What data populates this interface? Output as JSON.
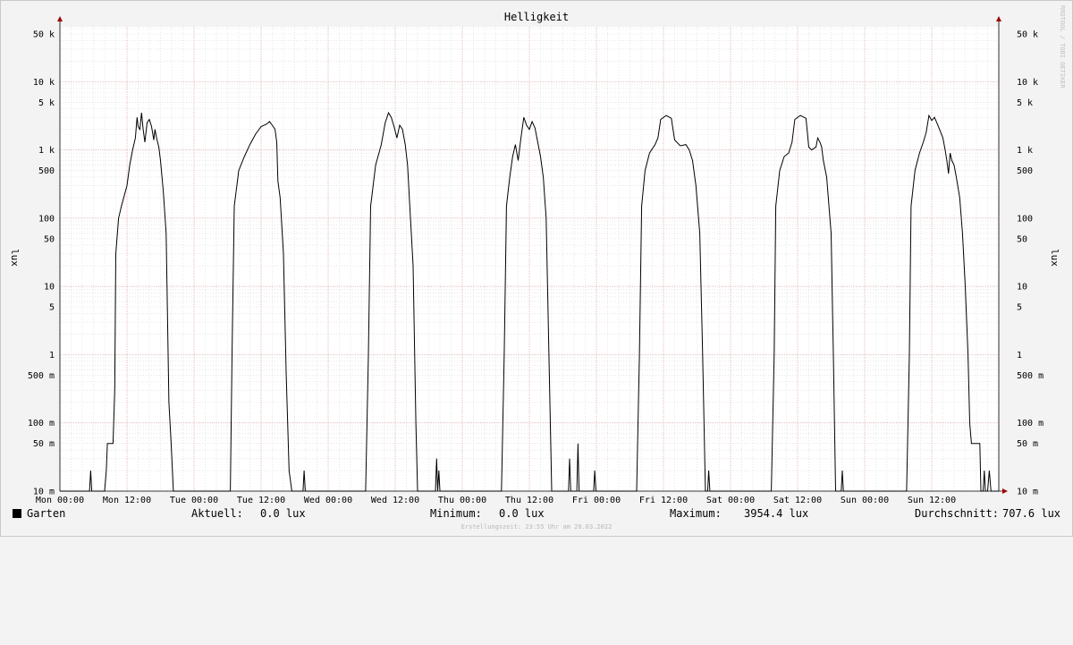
{
  "chart_data": {
    "type": "line",
    "title": "Helligkeit",
    "ylabel": "lux",
    "ylabel_right": "lux",
    "scale": "log",
    "ylim": [
      0.01,
      80000
    ],
    "xlim": [
      "Mon 00:00",
      "Mon 00:00 (next week)"
    ],
    "grid": true,
    "y_ticks": [
      {
        "value": 50000,
        "label": "50 k"
      },
      {
        "value": 10000,
        "label": "10 k"
      },
      {
        "value": 5000,
        "label": "5 k"
      },
      {
        "value": 1000,
        "label": "1 k"
      },
      {
        "value": 500,
        "label": "500"
      },
      {
        "value": 100,
        "label": "100"
      },
      {
        "value": 50,
        "label": "50"
      },
      {
        "value": 10,
        "label": "10"
      },
      {
        "value": 5,
        "label": "5"
      },
      {
        "value": 1,
        "label": "1"
      },
      {
        "value": 0.5,
        "label": "500 m"
      },
      {
        "value": 0.1,
        "label": "100 m"
      },
      {
        "value": 0.05,
        "label": "50 m"
      },
      {
        "value": 0.01,
        "label": "10 m"
      }
    ],
    "x_ticks": [
      "Mon 00:00",
      "Mon 12:00",
      "Tue 00:00",
      "Tue 12:00",
      "Wed 00:00",
      "Wed 12:00",
      "Thu 00:00",
      "Thu 12:00",
      "Fri 00:00",
      "Fri 12:00",
      "Sat 00:00",
      "Sat 12:00",
      "Sun 00:00",
      "Sun 12:00"
    ],
    "series": [
      {
        "name": "Garten",
        "color": "#000000",
        "x_unit": "hours since Mon 00:00",
        "points": [
          [
            0,
            0.01
          ],
          [
            5.3,
            0.01
          ],
          [
            5.5,
            0.02
          ],
          [
            5.7,
            0.01
          ],
          [
            8,
            0.01
          ],
          [
            8.3,
            0.02
          ],
          [
            8.5,
            0.05
          ],
          [
            9.5,
            0.05
          ],
          [
            9.8,
            0.3
          ],
          [
            10,
            30
          ],
          [
            10.5,
            100
          ],
          [
            11,
            150
          ],
          [
            12,
            300
          ],
          [
            12.5,
            600
          ],
          [
            13,
            1000
          ],
          [
            13.5,
            1500
          ],
          [
            13.8,
            3000
          ],
          [
            14,
            2200
          ],
          [
            14.3,
            2000
          ],
          [
            14.6,
            3500
          ],
          [
            14.9,
            2000
          ],
          [
            15.2,
            1300
          ],
          [
            15.6,
            2500
          ],
          [
            16,
            2800
          ],
          [
            16.4,
            2200
          ],
          [
            16.8,
            1400
          ],
          [
            17,
            2000
          ],
          [
            17.3,
            1500
          ],
          [
            17.7,
            1100
          ],
          [
            18,
            700
          ],
          [
            18.5,
            250
          ],
          [
            19,
            60
          ],
          [
            19.5,
            0.2
          ],
          [
            19.9,
            0.05
          ],
          [
            20.3,
            0.01
          ],
          [
            30.5,
            0.01
          ],
          [
            30.8,
            1
          ],
          [
            31.2,
            150
          ],
          [
            32,
            500
          ],
          [
            33,
            800
          ],
          [
            34,
            1200
          ],
          [
            35,
            1700
          ],
          [
            36,
            2200
          ],
          [
            37,
            2400
          ],
          [
            37.5,
            2600
          ],
          [
            38,
            2300
          ],
          [
            38.5,
            2000
          ],
          [
            38.8,
            1300
          ],
          [
            39,
            350
          ],
          [
            39.4,
            200
          ],
          [
            40,
            30
          ],
          [
            40.5,
            0.5
          ],
          [
            41,
            0.02
          ],
          [
            41.5,
            0.01
          ],
          [
            43.5,
            0.01
          ],
          [
            43.7,
            0.02
          ],
          [
            43.9,
            0.01
          ],
          [
            54.7,
            0.01
          ],
          [
            55.2,
            1
          ],
          [
            55.6,
            150
          ],
          [
            56.5,
            600
          ],
          [
            57.5,
            1200
          ],
          [
            58.2,
            2500
          ],
          [
            58.8,
            3500
          ],
          [
            59.3,
            3000
          ],
          [
            59.8,
            2200
          ],
          [
            60.3,
            1500
          ],
          [
            60.8,
            2300
          ],
          [
            61.3,
            2000
          ],
          [
            61.8,
            1200
          ],
          [
            62.2,
            600
          ],
          [
            62.6,
            150
          ],
          [
            63.2,
            20
          ],
          [
            63.7,
            0.1
          ],
          [
            64,
            0.01
          ],
          [
            67.2,
            0.01
          ],
          [
            67.4,
            0.03
          ],
          [
            67.6,
            0.01
          ],
          [
            67.8,
            0.02
          ],
          [
            68,
            0.01
          ],
          [
            79,
            0.01
          ],
          [
            79.5,
            1
          ],
          [
            79.9,
            150
          ],
          [
            80.5,
            400
          ],
          [
            81,
            800
          ],
          [
            81.5,
            1200
          ],
          [
            82,
            700
          ],
          [
            82.5,
            1500
          ],
          [
            83,
            3000
          ],
          [
            83.5,
            2300
          ],
          [
            84,
            2000
          ],
          [
            84.5,
            2600
          ],
          [
            85,
            2100
          ],
          [
            85.5,
            1300
          ],
          [
            86,
            800
          ],
          [
            86.5,
            400
          ],
          [
            87,
            100
          ],
          [
            87.5,
            1
          ],
          [
            88,
            0.01
          ],
          [
            91,
            0.01
          ],
          [
            91.2,
            0.03
          ],
          [
            91.4,
            0.01
          ],
          [
            92.5,
            0.01
          ],
          [
            92.7,
            0.05
          ],
          [
            92.9,
            0.01
          ],
          [
            95.5,
            0.01
          ],
          [
            95.7,
            0.02
          ],
          [
            95.9,
            0.01
          ],
          [
            103.2,
            0.01
          ],
          [
            103.7,
            1
          ],
          [
            104.1,
            150
          ],
          [
            104.7,
            500
          ],
          [
            105.5,
            900
          ],
          [
            106.5,
            1200
          ],
          [
            107,
            1500
          ],
          [
            107.5,
            2800
          ],
          [
            108.5,
            3200
          ],
          [
            109.4,
            2900
          ],
          [
            110,
            1400
          ],
          [
            111,
            1150
          ],
          [
            112,
            1200
          ],
          [
            112.6,
            1000
          ],
          [
            113.2,
            700
          ],
          [
            113.8,
            300
          ],
          [
            114.5,
            60
          ],
          [
            115,
            1
          ],
          [
            115.5,
            0.01
          ],
          [
            115.9,
            0.01
          ],
          [
            116.1,
            0.02
          ],
          [
            116.3,
            0.01
          ],
          [
            127.3,
            0.01
          ],
          [
            127.8,
            1
          ],
          [
            128.1,
            150
          ],
          [
            128.8,
            500
          ],
          [
            129.6,
            800
          ],
          [
            130.4,
            900
          ],
          [
            131,
            1300
          ],
          [
            131.5,
            2800
          ],
          [
            132.5,
            3200
          ],
          [
            133.5,
            2900
          ],
          [
            134,
            1100
          ],
          [
            134.5,
            1000
          ],
          [
            135.3,
            1100
          ],
          [
            135.6,
            1500
          ],
          [
            136,
            1300
          ],
          [
            136.3,
            1100
          ],
          [
            136.6,
            700
          ],
          [
            137.2,
            400
          ],
          [
            138,
            60
          ],
          [
            138.4,
            1
          ],
          [
            138.8,
            0.01
          ],
          [
            139.8,
            0.01
          ],
          [
            140,
            0.02
          ],
          [
            140.2,
            0.01
          ],
          [
            151.5,
            0.01
          ],
          [
            152,
            1
          ],
          [
            152.3,
            150
          ],
          [
            153,
            500
          ],
          [
            153.8,
            900
          ],
          [
            154.5,
            1300
          ],
          [
            155,
            1800
          ],
          [
            155.5,
            3200
          ],
          [
            156,
            2700
          ],
          [
            156.5,
            3000
          ],
          [
            157,
            2400
          ],
          [
            157.5,
            1900
          ],
          [
            158,
            1500
          ],
          [
            158.4,
            1000
          ],
          [
            158.7,
            700
          ],
          [
            159,
            450
          ],
          [
            159.3,
            900
          ],
          [
            159.6,
            700
          ],
          [
            160,
            600
          ],
          [
            160.4,
            400
          ],
          [
            161,
            200
          ],
          [
            161.5,
            60
          ],
          [
            162,
            10
          ],
          [
            162.5,
            1
          ],
          [
            162.8,
            0.1
          ],
          [
            163.1,
            0.05
          ],
          [
            164.6,
            0.05
          ],
          [
            164.8,
            0.01
          ],
          [
            165.2,
            0.01
          ],
          [
            165.4,
            0.02
          ],
          [
            165.6,
            0.01
          ],
          [
            166,
            0.01
          ],
          [
            166.3,
            0.02
          ],
          [
            166.6,
            0.01
          ],
          [
            168,
            0.01
          ]
        ]
      }
    ],
    "legend": {
      "name": "Garten",
      "current_label": "Aktuell:",
      "current_value": "0.0 lux",
      "minimum_label": "Minimum:",
      "minimum_value": "0.0 lux",
      "maximum_label": "Maximum:",
      "maximum_value": "3954.4 lux",
      "average_label": "Durchschnitt:",
      "average_value": "707.6 lux"
    }
  },
  "watermark": "RRDTOOL / TOBI OETIKER",
  "footer": "Erstellungszeit: 23:55 Uhr am 20.03.2022"
}
